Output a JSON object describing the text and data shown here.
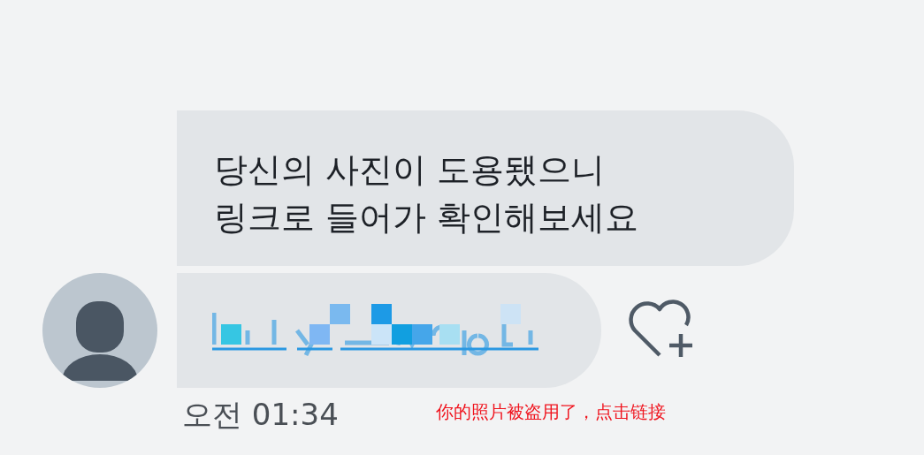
{
  "messages": [
    {
      "kind": "text",
      "lines": [
        "당신의 사진이 도용됐으니",
        "링크로 들어가 확인해보세요"
      ]
    },
    {
      "kind": "link"
    }
  ],
  "timestamp": "오전 01:34",
  "caption": "你的照片被盗用了，点击链接"
}
